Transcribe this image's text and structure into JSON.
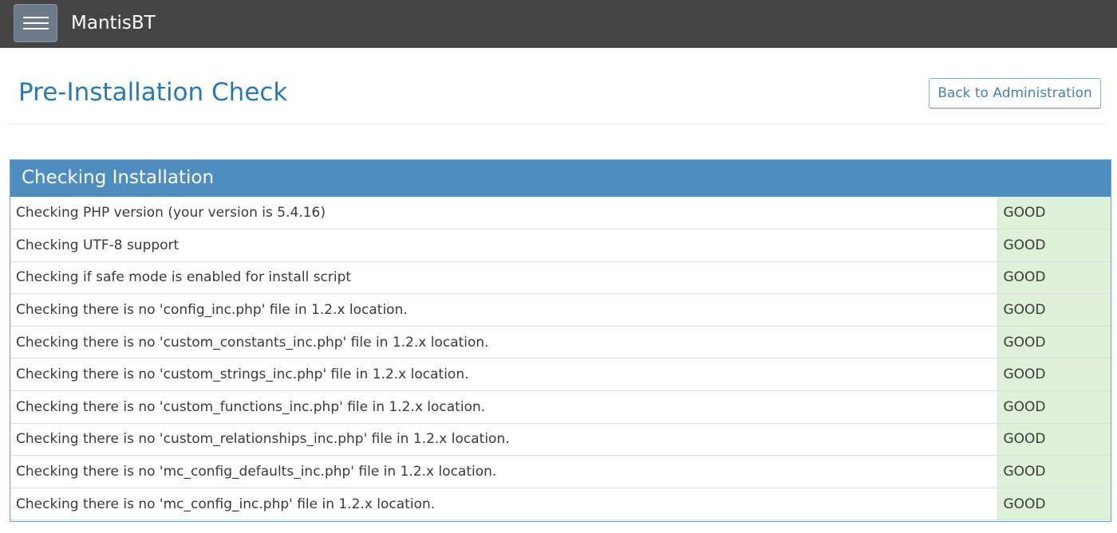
{
  "navbar": {
    "brand": "MantisBT"
  },
  "header": {
    "title": "Pre-Installation Check",
    "back_button": "Back to Administration"
  },
  "panel": {
    "title": "Checking Installation",
    "checks": [
      {
        "label": "Checking PHP version (your version is 5.4.16)",
        "result": "GOOD"
      },
      {
        "label": "Checking UTF-8 support",
        "result": "GOOD"
      },
      {
        "label": "Checking if safe mode is enabled for install script",
        "result": "GOOD"
      },
      {
        "label": "Checking there is no 'config_inc.php' file in 1.2.x location.",
        "result": "GOOD"
      },
      {
        "label": "Checking there is no 'custom_constants_inc.php' file in 1.2.x location.",
        "result": "GOOD"
      },
      {
        "label": "Checking there is no 'custom_strings_inc.php' file in 1.2.x location.",
        "result": "GOOD"
      },
      {
        "label": "Checking there is no 'custom_functions_inc.php' file in 1.2.x location.",
        "result": "GOOD"
      },
      {
        "label": "Checking there is no 'custom_relationships_inc.php' file in 1.2.x location.",
        "result": "GOOD"
      },
      {
        "label": "Checking there is no 'mc_config_defaults_inc.php' file in 1.2.x location.",
        "result": "GOOD"
      },
      {
        "label": "Checking there is no 'mc_config_inc.php' file in 1.2.x location.",
        "result": "GOOD"
      }
    ]
  },
  "colors": {
    "navbar_bg": "#444444",
    "title_blue": "#2679b5",
    "panel_header": "#4f8cc0",
    "good_bg": "#dff0d8"
  }
}
